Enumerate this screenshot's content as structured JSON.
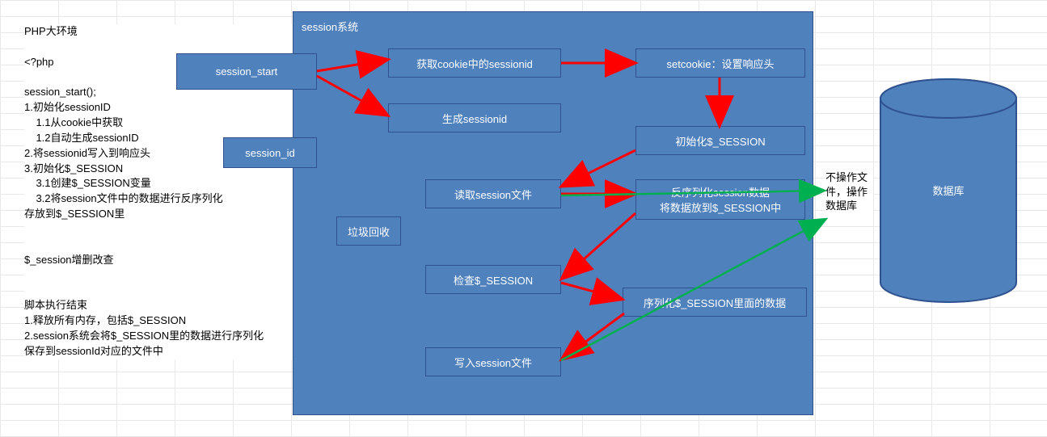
{
  "title": "PHP大环境",
  "text_lines": "PHP大环境\n\n<?php\n\nsession_start();\n1.初始化sessionID\n    1.1从cookie中获取\n    1.2自动生成sessionID\n2.将sessionid写入到响应头\n3.初始化$_SESSION\n    3.1创建$_SESSION变量\n    3.2将session文件中的数据进行反序列化\n存放到$_SESSION里\n\n\n$_session增删改查\n\n\n脚本执行结束\n1.释放所有内存，包括$_SESSION\n2.session系统会将$_SESSION里的数据进行序列化\n保存到sessionId对应的文件中",
  "session_system_title": "session系统",
  "boxes": {
    "session_start": "session_start",
    "session_id": "session_id",
    "garbage": "垃圾回收",
    "get_cookie": "获取cookie中的sessionid",
    "gen_sid": "生成sessionid",
    "read_file": "读取session文件",
    "check": "检查$_SESSION",
    "write_file": "写入session文件",
    "setcookie": "setcookie：设置响应头",
    "init_sess": "初始化$_SESSION",
    "deser": "反序列化session数据\n将数据放到$_SESSION中",
    "serialize": "序列化$_SESSION里面的数据"
  },
  "note": "不操作文件，操作数据库",
  "db_label": "数据库"
}
